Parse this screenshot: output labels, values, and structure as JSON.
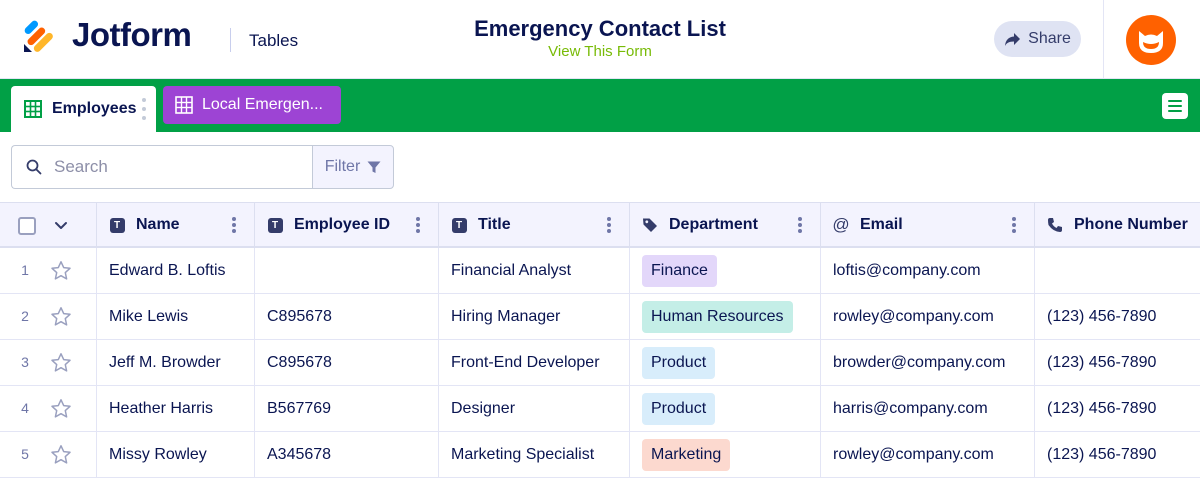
{
  "header": {
    "brand": "Jotform",
    "section": "Tables",
    "title": "Emergency Contact List",
    "form_link": "View This Form",
    "share_label": "Share"
  },
  "tabs": [
    {
      "label": "Employees",
      "active": true,
      "icon": "table-icon"
    },
    {
      "label": "Local Emergen...",
      "active": false,
      "icon": "table-icon"
    }
  ],
  "toolbar": {
    "search_placeholder": "Search",
    "filter_label": "Filter"
  },
  "table": {
    "columns": [
      {
        "label": "Name",
        "icon": "text-type-icon"
      },
      {
        "label": "Employee ID",
        "icon": "text-type-icon"
      },
      {
        "label": "Title",
        "icon": "text-type-icon"
      },
      {
        "label": "Department",
        "icon": "tag-icon"
      },
      {
        "label": "Email",
        "icon": "at-icon"
      },
      {
        "label": "Phone Number",
        "icon": "phone-icon"
      }
    ],
    "rows": [
      {
        "num": "1",
        "name": "Edward B. Loftis",
        "employee_id": "",
        "title": "Financial Analyst",
        "department": "Finance",
        "email": "loftis@company.com",
        "phone": ""
      },
      {
        "num": "2",
        "name": "Mike Lewis",
        "employee_id": "C895678",
        "title": "Hiring Manager",
        "department": "Human Resources",
        "email": "rowley@company.com",
        "phone": "(123) 456-7890"
      },
      {
        "num": "3",
        "name": "Jeff M. Browder",
        "employee_id": "C895678",
        "title": "Front-End Developer",
        "department": "Product",
        "email": "browder@company.com",
        "phone": "(123) 456-7890"
      },
      {
        "num": "4",
        "name": "Heather Harris",
        "employee_id": "B567769",
        "title": "Designer",
        "department": "Product",
        "email": "harris@company.com",
        "phone": "(123) 456-7890"
      },
      {
        "num": "5",
        "name": "Missy Rowley",
        "employee_id": "A345678",
        "title": "Marketing Specialist",
        "department": "Marketing",
        "email": "rowley@company.com",
        "phone": "(123) 456-7890"
      }
    ]
  },
  "colors": {
    "brand_navy": "#0a1551",
    "tabbar_green": "#01a046",
    "tab_purple": "#9d44d4",
    "link_green": "#78bb07",
    "avatar_orange": "#ff6100",
    "dept_finance": "#e3d7fa",
    "dept_hr": "#c4eee7",
    "dept_product": "#d8edfb",
    "dept_marketing": "#fcd9cf"
  }
}
